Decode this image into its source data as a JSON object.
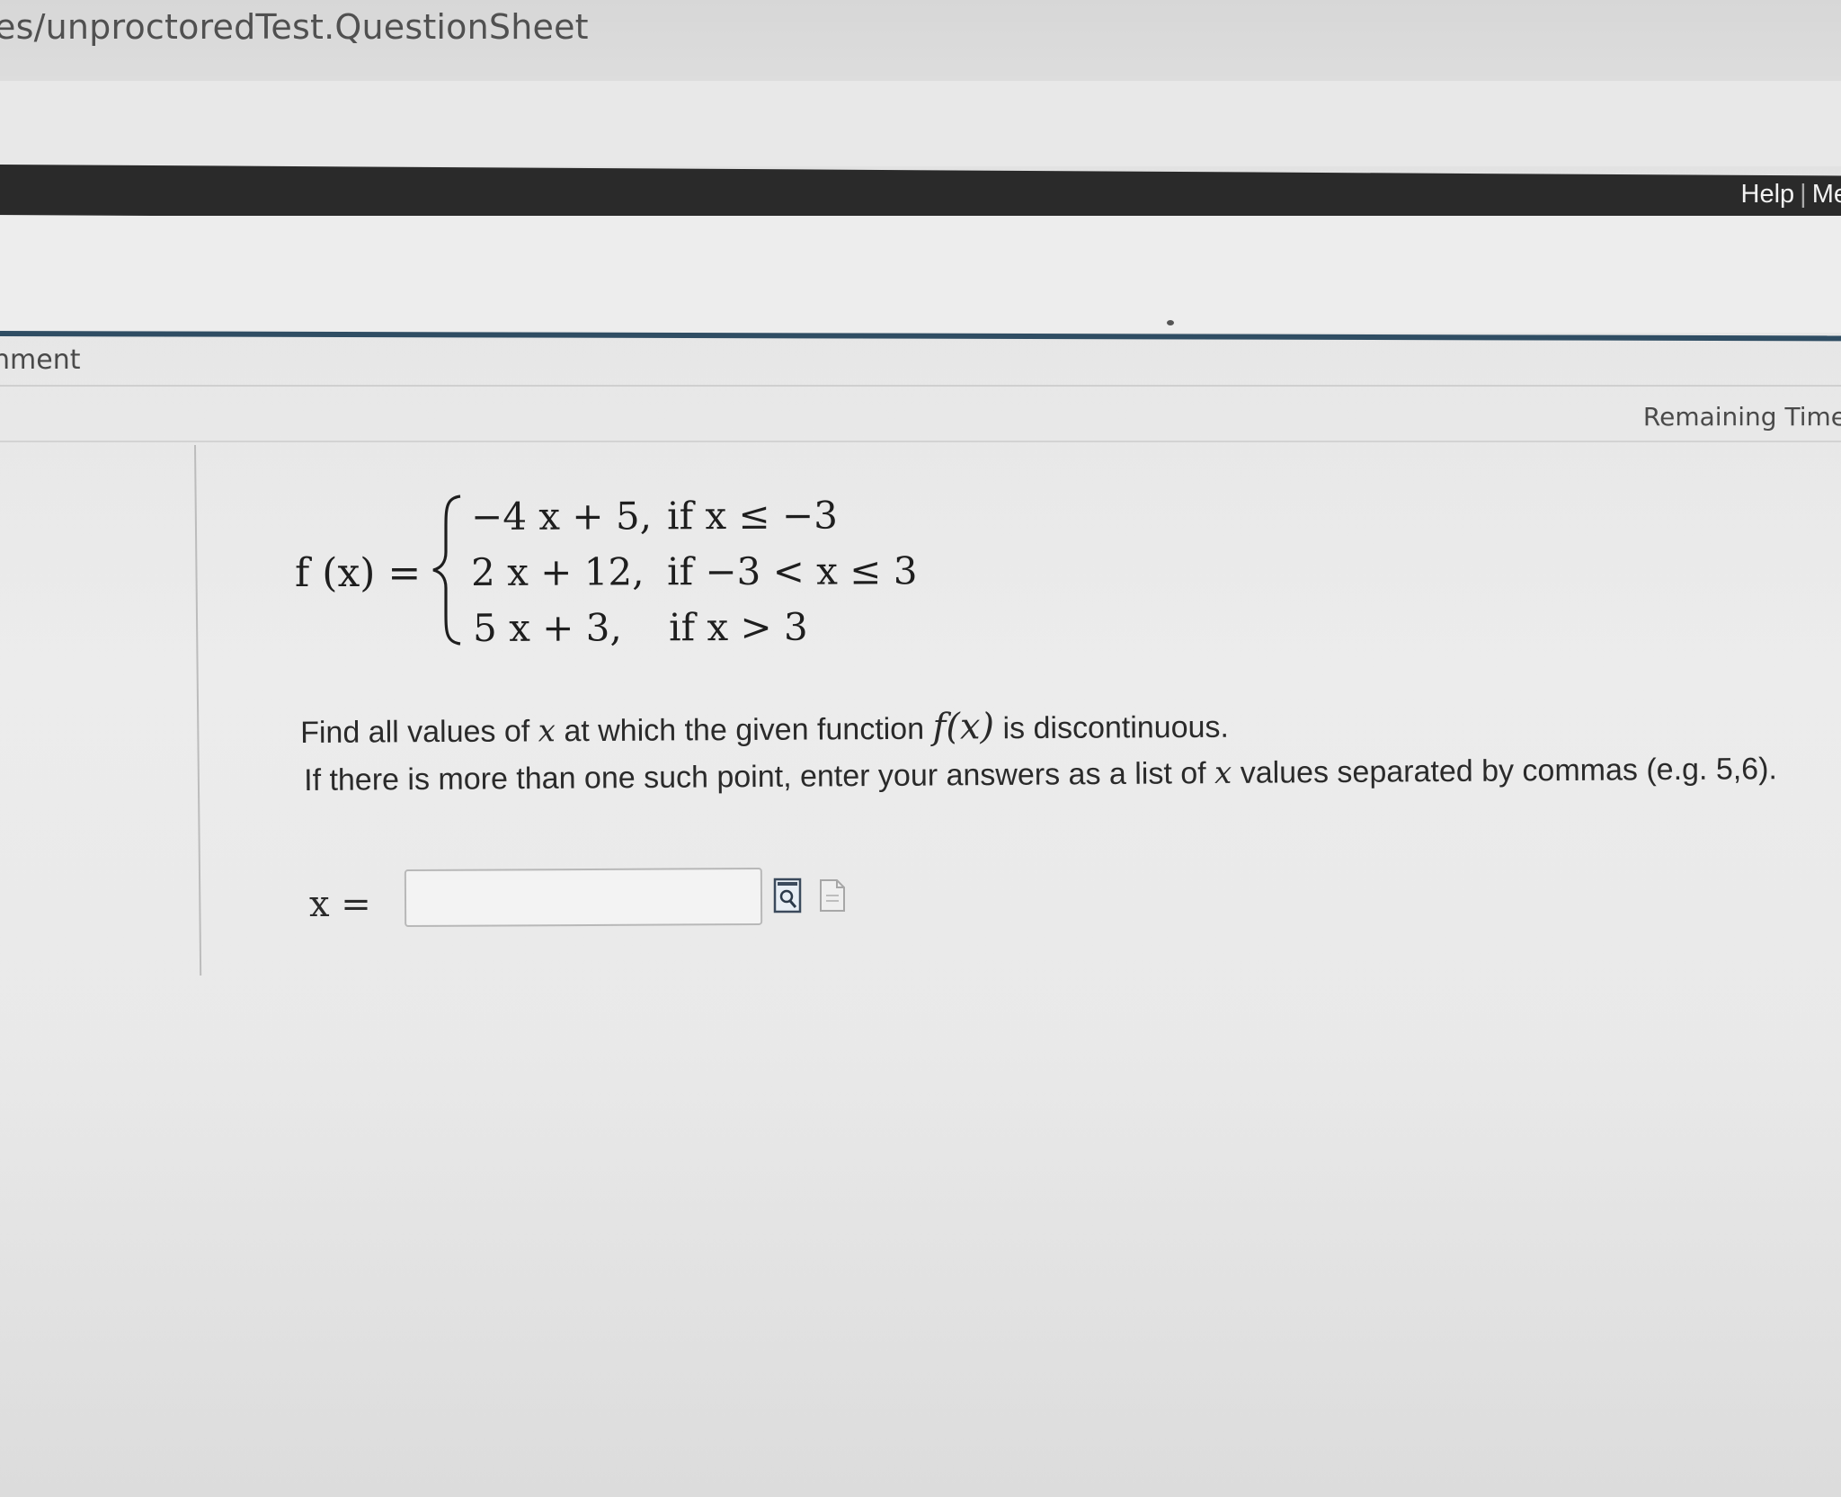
{
  "browser": {
    "url_visible": "es/unproctoredTest.QuestionSheet"
  },
  "nav": {
    "help_label": "Help",
    "separator": "|",
    "me_label": "Me"
  },
  "header": {
    "assignment_label": "nment",
    "remaining_time_label": "Remaining Time"
  },
  "problem": {
    "function_lhs": "f (x) =",
    "cases": [
      {
        "expr": "−4 x + 5,",
        "cond": "if x ≤ −3"
      },
      {
        "expr": "2 x + 12,",
        "cond": "if −3 < x ≤ 3"
      },
      {
        "expr": "5 x + 3,",
        "cond": "if x > 3"
      }
    ],
    "question_line1_a": "Find all values of ",
    "question_var": "x",
    "question_line1_b": " at which the given function ",
    "question_fx": "f(x)",
    "question_line1_c": " is discontinuous.",
    "question_line2_a": "If there is more than one such point, enter your answers as a list of ",
    "question_line2_b": " values separated by commas (e.g. 5,6).",
    "answer_label": "x =",
    "answer_value": ""
  },
  "icons": {
    "preview": "preview-icon",
    "help_doc": "help-doc-icon"
  }
}
